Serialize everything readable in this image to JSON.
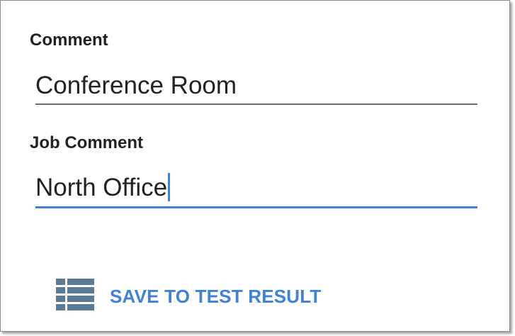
{
  "form": {
    "comment": {
      "label": "Comment",
      "value": "Conference Room"
    },
    "job_comment": {
      "label": "Job Comment",
      "value": "North Office"
    }
  },
  "actions": {
    "save_label": "SAVE TO TEST RESULT",
    "save_icon": "list-icon"
  },
  "colors": {
    "accent": "#3f80d8",
    "icon": "#5b7a93",
    "text": "#222222",
    "underline_inactive": "#6b6b6b"
  }
}
